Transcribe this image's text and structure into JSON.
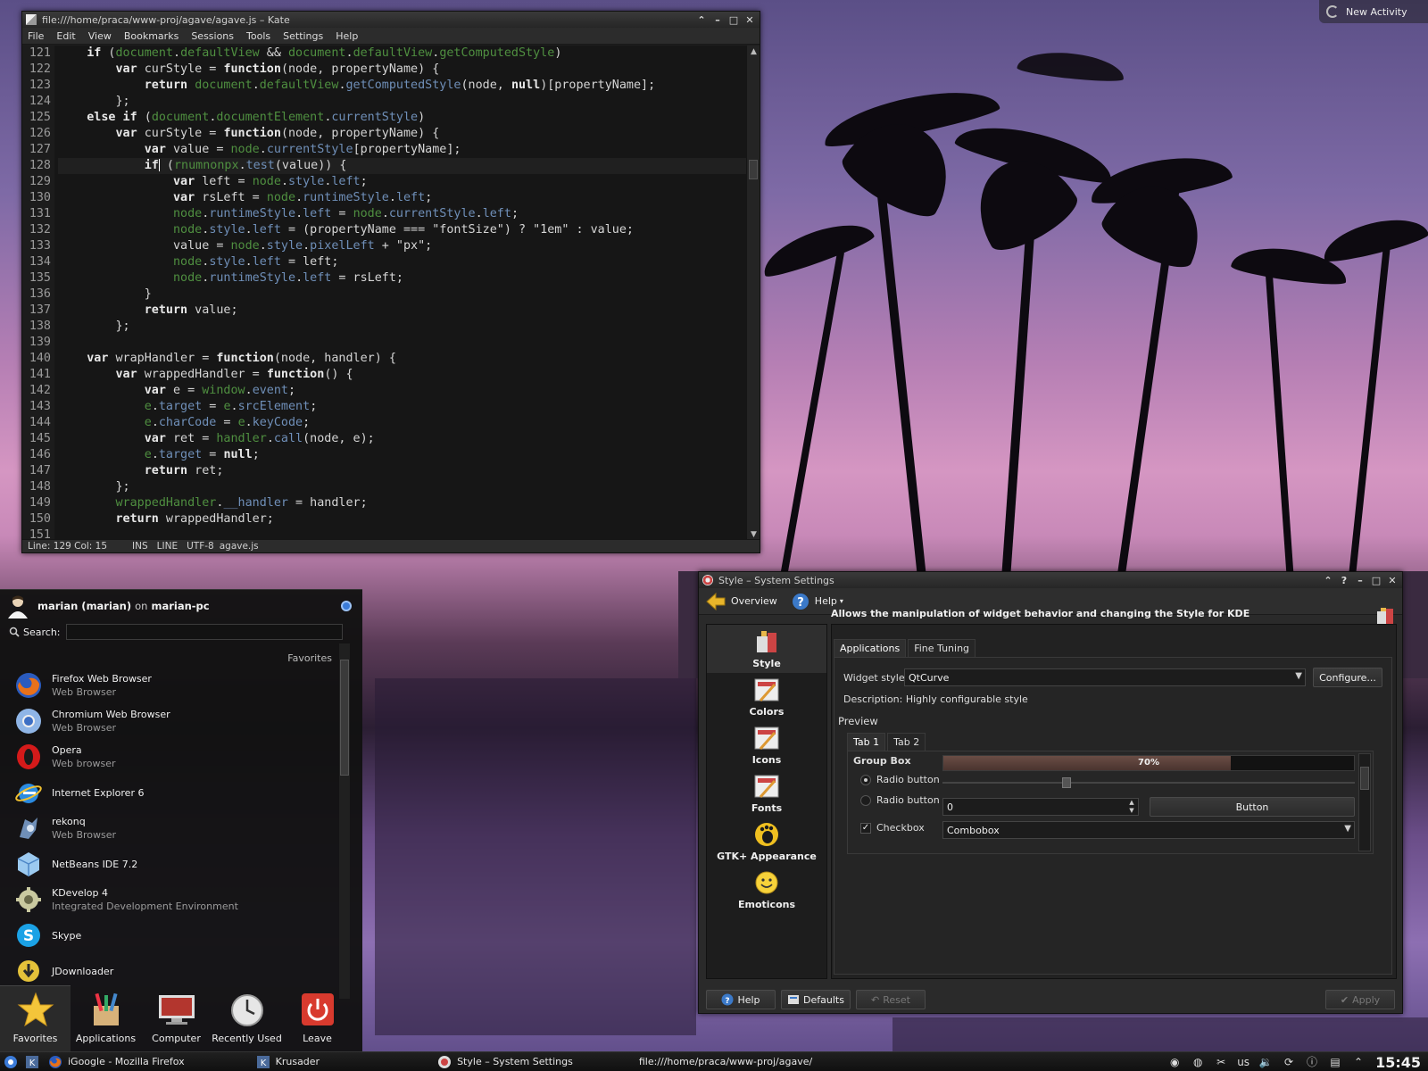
{
  "activity": {
    "label": "New Activity"
  },
  "kate": {
    "title": "file:///home/praca/www-proj/agave/agave.js – Kate",
    "menu": [
      "File",
      "Edit",
      "View",
      "Bookmarks",
      "Sessions",
      "Tools",
      "Settings",
      "Help"
    ],
    "status": {
      "position": "Line: 129 Col: 15",
      "mode": "INS",
      "select": "LINE",
      "encoding": "UTF-8",
      "file": "agave.js"
    },
    "line_numbers": [
      "121",
      "122",
      "123",
      "124",
      "125",
      "126",
      "127",
      "128",
      "129",
      "130",
      "131",
      "132",
      "133",
      "134",
      "135",
      "136",
      "137",
      "138",
      "139",
      "140",
      "141",
      "142",
      "143",
      "144",
      "145",
      "146",
      "147",
      "148",
      "149",
      "150",
      "151"
    ],
    "current_line_index": 8
  },
  "kickoff": {
    "user": "marian (marian)",
    "on": "on",
    "host": "marian-pc",
    "search_label": "Search:",
    "search_value": "",
    "section": "Favorites",
    "apps": [
      {
        "name": "Firefox Web Browser",
        "desc": "Web Browser",
        "icon": "firefox-icon"
      },
      {
        "name": "Chromium Web Browser",
        "desc": "Web Browser",
        "icon": "chromium-icon"
      },
      {
        "name": "Opera",
        "desc": "Web browser",
        "icon": "opera-icon"
      },
      {
        "name": "Internet Explorer 6",
        "desc": "",
        "icon": "internet-explorer-icon"
      },
      {
        "name": "rekonq",
        "desc": "Web Browser",
        "icon": "rekonq-icon"
      },
      {
        "name": "NetBeans IDE 7.2",
        "desc": "",
        "icon": "netbeans-icon"
      },
      {
        "name": "KDevelop 4",
        "desc": "Integrated Development Environment",
        "icon": "kdevelop-icon"
      },
      {
        "name": "Skype",
        "desc": "",
        "icon": "skype-icon"
      },
      {
        "name": "JDownloader",
        "desc": "",
        "icon": "jdownloader-icon"
      }
    ],
    "tabs": [
      "Favorites",
      "Applications",
      "Computer",
      "Recently Used",
      "Leave"
    ]
  },
  "settings": {
    "title": "Style – System Settings",
    "toolbar": {
      "overview": "Overview",
      "help": "Help"
    },
    "categories": [
      "Style",
      "Colors",
      "Icons",
      "Fonts",
      "GTK+ Appearance",
      "Emoticons"
    ],
    "header": "Allows the manipulation of widget behavior and changing the Style for KDE",
    "tabs": [
      "Applications",
      "Fine Tuning"
    ],
    "widget_style_label": "Widget style:",
    "widget_style_value": "QtCurve",
    "configure": "Configure...",
    "description": "Description: Highly configurable style",
    "preview_label": "Preview",
    "preview_tabs": [
      "Tab 1",
      "Tab 2"
    ],
    "group_box": "Group Box",
    "radio1": "Radio button",
    "radio2": "Radio button",
    "checkbox": "Checkbox",
    "progress_text": "70%",
    "progress_value": 0.7,
    "slider_value": 0.3,
    "spin_value": "0",
    "button": "Button",
    "combobox": "Combobox",
    "buttons": {
      "help": "Help",
      "defaults": "Defaults",
      "reset": "Reset",
      "apply": "Apply"
    }
  },
  "taskbar": {
    "tasks": [
      "iGoogle - Mozilla Firefox",
      "Krusader",
      "Style – System Settings",
      "file:///home/praca/www-proj/agave/"
    ],
    "keyboard": "us",
    "clock": "15:45"
  }
}
